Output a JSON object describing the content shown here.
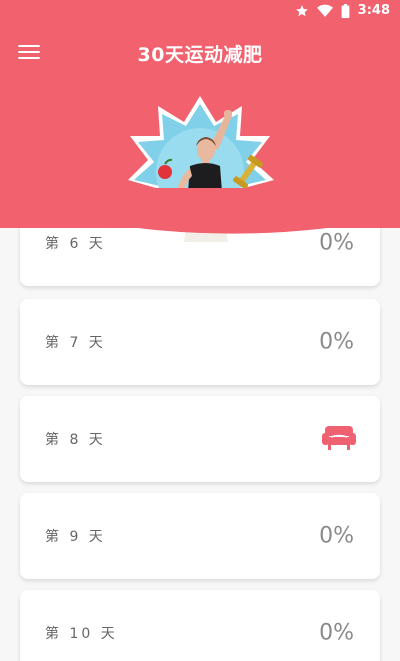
{
  "status_bar": {
    "time": "3:48",
    "icons": [
      "star-icon",
      "wifi-icon",
      "battery-icon"
    ]
  },
  "header": {
    "title": "30天运动减肥",
    "menu_icon": "menu-icon"
  },
  "colors": {
    "brand": "#f1616e",
    "rest_icon": "#ef6170"
  },
  "days": [
    {
      "label": "第 6 天",
      "progress": "0%"
    },
    {
      "label": "第 7 天",
      "progress": "0%"
    },
    {
      "label": "第 8 天",
      "rest": true,
      "icon": "sofa-icon"
    },
    {
      "label": "第 9 天",
      "progress": "0%"
    },
    {
      "label": "第 10 天",
      "progress": "0%"
    }
  ]
}
